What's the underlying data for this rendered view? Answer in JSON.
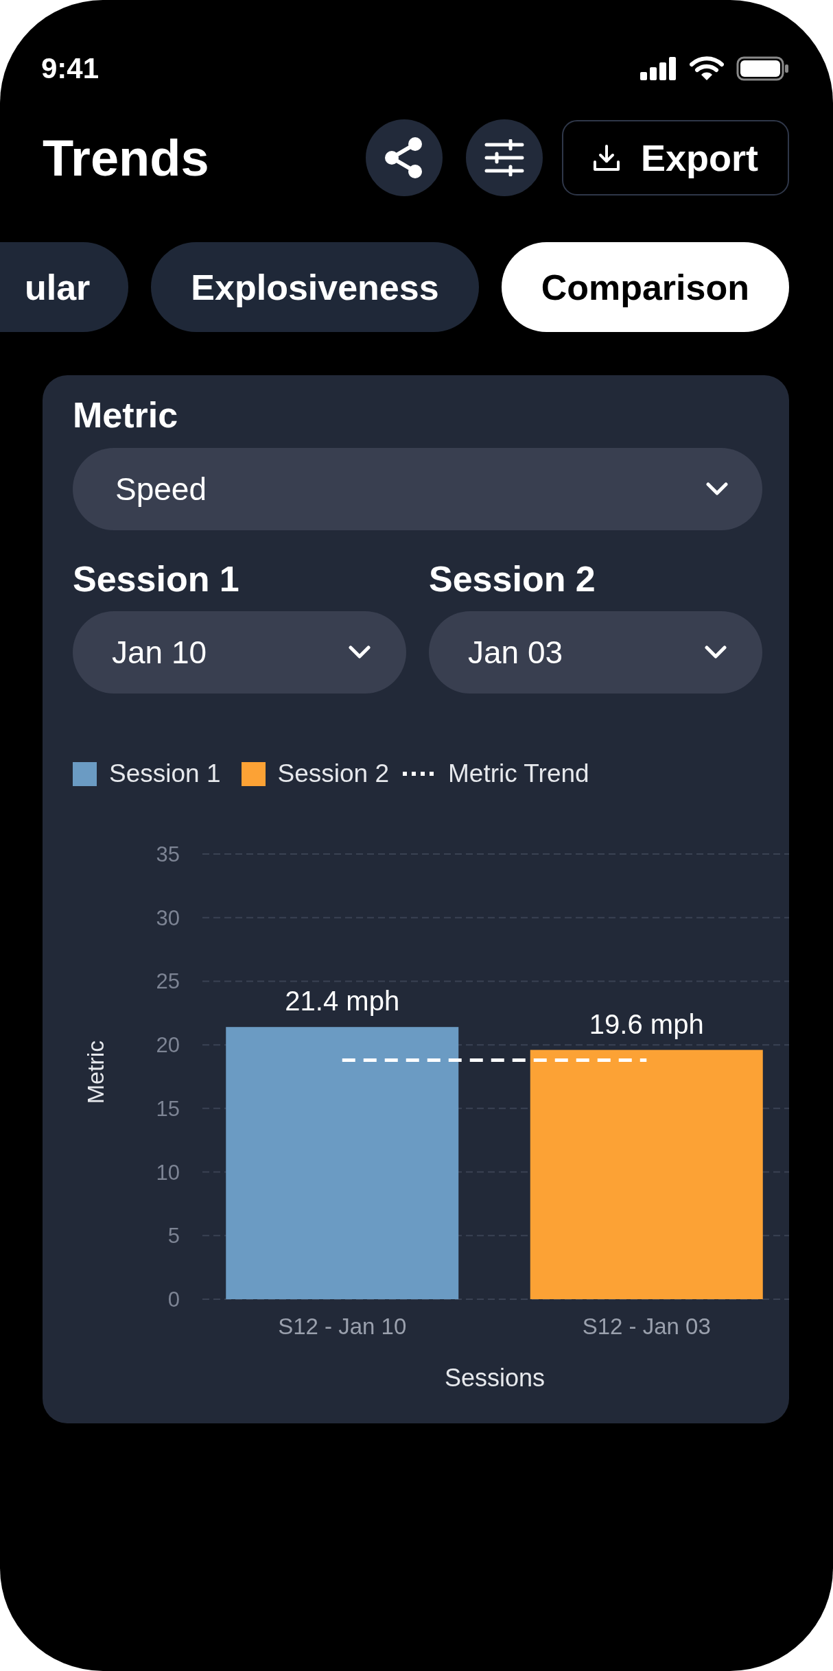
{
  "status_bar": {
    "time": "9:41"
  },
  "header": {
    "title": "Trends",
    "export_label": "Export"
  },
  "tabs": [
    {
      "label": "ular",
      "selected": false
    },
    {
      "label": "Explosiveness",
      "selected": false
    },
    {
      "label": "Comparison",
      "selected": true
    }
  ],
  "card": {
    "metric": {
      "label": "Metric",
      "value": "Speed"
    },
    "sessions": [
      {
        "label": "Session 1",
        "value": "Jan 10"
      },
      {
        "label": "Session 2",
        "value": "Jan 03"
      }
    ],
    "chart_data": {
      "type": "bar",
      "xlabel": "Sessions",
      "ylabel": "Metric",
      "categories": [
        "S12 - Jan 10",
        "S12 - Jan 03"
      ],
      "series": [
        {
          "name": "Session 1",
          "color": "#6b9bc3",
          "values": [
            21.4,
            null
          ]
        },
        {
          "name": "Session 2",
          "color": "#fca235",
          "values": [
            null,
            19.6
          ]
        },
        {
          "name": "Metric Trend",
          "type": "line",
          "line_style": "dashed",
          "color": "#ffffff",
          "values": [
            18.8,
            18.8
          ]
        }
      ],
      "grid": true,
      "ylim": [
        0,
        35
      ],
      "yticks": [
        0,
        5,
        10,
        15,
        20,
        25,
        30,
        35
      ],
      "value_labels": [
        "21.4 mph",
        "19.6 mph"
      ]
    }
  }
}
